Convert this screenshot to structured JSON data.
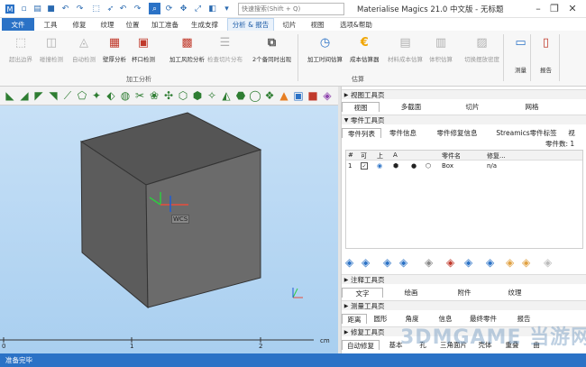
{
  "app": {
    "title": "Materialise Magics 21.0 中文版 - 无标题"
  },
  "search": {
    "placeholder": "快速搜索(Shift + Q)"
  },
  "tabs": [
    {
      "label": "文件",
      "style": "file"
    },
    {
      "label": "工具"
    },
    {
      "label": "修复"
    },
    {
      "label": "纹理"
    },
    {
      "label": "位置"
    },
    {
      "label": "加工准备"
    },
    {
      "label": "生成支撑"
    },
    {
      "label": "分析 & 报告",
      "active": true
    },
    {
      "label": "切片"
    },
    {
      "label": "视图"
    },
    {
      "label": "选项&帮助"
    }
  ],
  "ribbon": {
    "buttons": [
      {
        "label": "超出边界",
        "icon": "out-of-bounds-icon",
        "disabled": true
      },
      {
        "label": "碰撞检测",
        "icon": "collision-icon",
        "disabled": true
      },
      {
        "label": "自动检测",
        "icon": "auto-detect-icon",
        "disabled": true
      },
      {
        "label": "壁厚分析",
        "icon": "wall-thickness-icon"
      },
      {
        "label": "杯口检测",
        "icon": "cup-detect-icon"
      },
      {
        "label": "加工风险分析",
        "icon": "build-risk-icon"
      },
      {
        "label": "检查切片分布",
        "icon": "slice-check-icon",
        "disabled": true
      },
      {
        "label": "2个备同时出现",
        "icon": "twin-icon"
      },
      {
        "label": "加工时间估算",
        "icon": "clock-icon"
      },
      {
        "label": "成本估算器",
        "icon": "euro-icon"
      },
      {
        "label": "材料成本估算",
        "icon": "material-cost-icon",
        "disabled": true
      },
      {
        "label": "体积估算",
        "icon": "volume-icon",
        "disabled": true
      },
      {
        "label": "切换摆放密度",
        "icon": "density-icon",
        "disabled": true
      },
      {
        "label": "测量",
        "icon": "measure-icon"
      },
      {
        "label": "报告",
        "icon": "report-icon"
      }
    ],
    "groups": [
      "加工分析",
      "估算"
    ]
  },
  "viewport": {
    "cs_label": "WCS",
    "ruler": [
      "0",
      "1",
      "2"
    ],
    "ruler_unit": "cm"
  },
  "panels": {
    "view_toolbar": {
      "title": "视图工具页",
      "tabs": [
        "视图",
        "多截面",
        "切片",
        "网格"
      ]
    },
    "part_toolbar": {
      "title": "零件工具页",
      "tabs": [
        "零件列表",
        "零件信息",
        "零件修复信息",
        "Streamics零件标签",
        "视"
      ],
      "count_label": "零件数: 1",
      "columns": [
        "#",
        "可",
        "上",
        "A",
        "零件名",
        "修复..."
      ],
      "rows": [
        {
          "num": "1",
          "name": "Box",
          "repair": "n/a"
        }
      ]
    },
    "annotation_toolbar": {
      "title": "注释工具页",
      "tabs": [
        "文字",
        "绘画",
        "附件",
        "纹理"
      ]
    },
    "measure_toolbar": {
      "title": "测量工具页",
      "tabs": [
        "距离",
        "圆形",
        "角度",
        "信息",
        "最终零件",
        "报告"
      ]
    },
    "repair_toolbar": {
      "title": "修复工具页",
      "tabs": [
        "自动修复",
        "基本",
        "孔",
        "三角面片",
        "壳体",
        "重叠",
        "曲"
      ]
    }
  },
  "status": {
    "text": "准备完毕"
  },
  "watermark": "3DMGAME 当游网",
  "colors": {
    "accent": "#2b72c6",
    "viewport_bg": "#b8d8f3",
    "cube_front": "#6b6b6b"
  }
}
